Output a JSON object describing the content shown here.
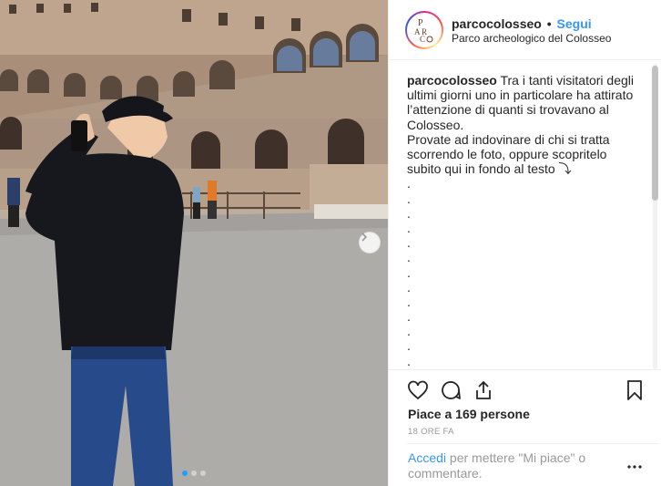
{
  "post": {
    "username": "parcocolosseo",
    "separator": "•",
    "follow_label": "Segui",
    "location": "Parco archeologico del Colosseo",
    "avatar_text": "PArCo"
  },
  "caption": {
    "username": "parcocolosseo",
    "lines": [
      " Tra i tanti visitatori degli",
      "ultimi giorni uno in particolare ha attirato",
      "l’attenzione di quanti si trovavano al",
      "Colosseo.",
      "Provate ad indovinare di chi si tratta",
      "scorrendo le foto, oppure scopritelo",
      "subito qui in fondo al testo ⤵"
    ],
    "dots": [
      ".",
      ".",
      ".",
      ".",
      ".",
      ".",
      ".",
      ".",
      ".",
      ".",
      ".",
      ".",
      "."
    ]
  },
  "engagement": {
    "likes": "Piace a 169 persone",
    "timestamp": "18 ORE FA"
  },
  "comment_prompt": {
    "login": "Accedi",
    "rest": " per mettere \"Mi piace\" o commentare."
  },
  "icons": {
    "like": "heart-icon",
    "comment": "comment-icon",
    "share": "share-icon",
    "save": "bookmark-icon",
    "more": "more-options-icon",
    "next": "chevron-right-icon"
  },
  "carousel": {
    "slides": 3,
    "active": 0
  },
  "colors": {
    "link": "#3897f0",
    "muted": "#999999",
    "text": "#262626"
  }
}
